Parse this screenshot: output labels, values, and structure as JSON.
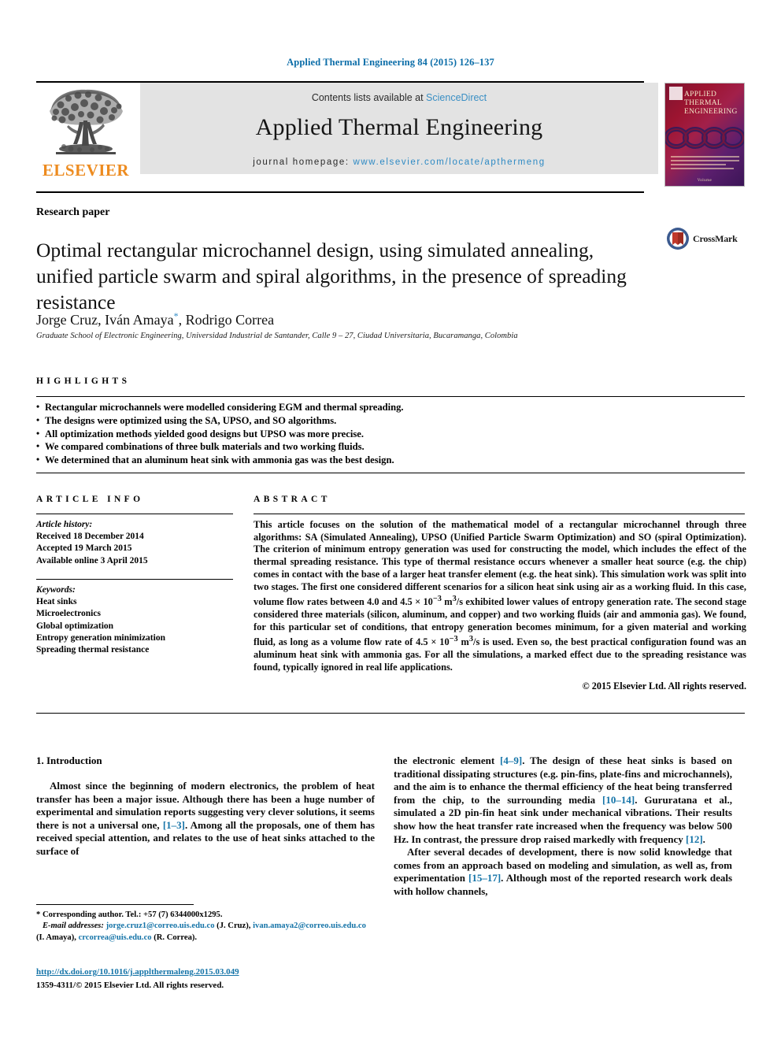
{
  "running_head": "Applied Thermal Engineering 84 (2015) 126–137",
  "masthead": {
    "publisher_name": "ELSEVIER",
    "contents_prefix": "Contents lists available at ",
    "contents_link": "ScienceDirect",
    "journal_title": "Applied Thermal Engineering",
    "homepage_prefix": "journal homepage: ",
    "homepage_link": "www.elsevier.com/locate/apthermeng",
    "cover": {
      "line1": "APPLIED",
      "line2": "THERMAL",
      "line3": "ENGINEERING",
      "footer": "Volume"
    }
  },
  "article": {
    "type": "Research paper",
    "title": "Optimal rectangular microchannel design, using simulated annealing, unified particle swarm and spiral algorithms, in the presence of spreading resistance",
    "crossmark_label": "CrossMark",
    "authors": "Jorge Cruz, Iván Amaya",
    "authors_suffix": ", Rodrigo Correa",
    "corresponding_marker": "*",
    "affiliation": "Graduate School of Electronic Engineering, Universidad Industrial de Santander, Calle 9 – 27, Ciudad Universitaria, Bucaramanga, Colombia"
  },
  "highlights": {
    "heading": "HIGHLIGHTS",
    "items": [
      "Rectangular microchannels were modelled considering EGM and thermal spreading.",
      "The designs were optimized using the SA, UPSO, and SO algorithms.",
      "All optimization methods yielded good designs but UPSO was more precise.",
      "We compared combinations of three bulk materials and two working fluids.",
      "We determined that an aluminum heat sink with ammonia gas was the best design."
    ]
  },
  "article_info": {
    "heading": "ARTICLE INFO",
    "history_label": "Article history:",
    "history": [
      "Received 18 December 2014",
      "Accepted 19 March 2015",
      "Available online 3 April 2015"
    ],
    "keywords_label": "Keywords:",
    "keywords": [
      "Heat sinks",
      "Microelectronics",
      "Global optimization",
      "Entropy generation minimization",
      "Spreading thermal resistance"
    ]
  },
  "abstract": {
    "heading": "ABSTRACT",
    "paragraph_1": "This article focuses on the solution of the mathematical model of a rectangular microchannel through three algorithms: SA (Simulated Annealing), UPSO (Unified Particle Swarm Optimization) and SO (spiral Optimization). The criterion of minimum entropy generation was used for constructing the model, which includes the effect of the thermal spreading resistance. This type of thermal resistance occurs whenever a smaller heat source (e.g. the chip) comes in contact with the base of a larger heat transfer element (e.g. the heat sink). This simulation work was split into two stages. The first one considered different scenarios for a silicon heat sink using air as a working fluid. In this case, volume flow rates between 4.0 and ",
    "flow_value_1": "4.5 × 10",
    "flow_exp_1": "−3",
    "flow_unit_1": " m",
    "flow_unit_sup_1": "3",
    "flow_unit_tail_1": "/s",
    "paragraph_2": " exhibited lower values of entropy generation rate. The second stage considered three materials (silicon, aluminum, and copper) and two working fluids (air and ammonia gas). We found, for this particular set of conditions, that entropy generation becomes minimum, for a given material and working fluid, as long as a volume flow rate of ",
    "paragraph_3": " is used. Even so, the best practical configuration found was an aluminum heat sink with ammonia gas. For all the simulations, a marked effect due to the spreading resistance was found, typically ignored in real life applications.",
    "copyright": "© 2015 Elsevier Ltd. All rights reserved."
  },
  "body": {
    "section_number_title": "1. Introduction",
    "left_paragraph": "Almost since the beginning of modern electronics, the problem of heat transfer has been a major issue. Although there has been a huge number of experimental and simulation reports suggesting very clever solutions, it seems there is not a universal one, ",
    "left_ref": "[1–3]",
    "left_paragraph_cont": ". Among all the proposals, one of them has received special attention, and relates to the use of heat sinks attached to the surface of",
    "right_paragraph_a_1": "the electronic element ",
    "right_ref_1": "[4–9]",
    "right_paragraph_a_2": ". The design of these heat sinks is based on traditional dissipating structures (e.g. pin-fins, plate-fins and microchannels), and the aim is to enhance the thermal efficiency of the heat being transferred from the chip, to the surrounding media ",
    "right_ref_2": "[10–14]",
    "right_paragraph_a_3": ". Gururatana et al., simulated a 2D pin-fin heat sink under mechanical vibrations. Their results show how the heat transfer rate increased when the frequency was below 500 Hz. In contrast, the pressure drop raised markedly with frequency ",
    "right_ref_3": "[12]",
    "right_paragraph_a_4": ".",
    "right_paragraph_b_1": "After several decades of development, there is now solid knowledge that comes from an approach based on modeling and simulation, as well as, from experimentation ",
    "right_ref_4": "[15–17]",
    "right_paragraph_b_2": ". Although most of the reported research work deals with hollow channels,"
  },
  "footnote": {
    "corresponding": "Corresponding author. Tel.: +57 (7) 6344000x1295.",
    "email_label": "E-mail addresses:",
    "email_1": "jorge.cruz1@correo.uis.edu.co",
    "email_1_who": "(J. Cruz),",
    "email_2": "ivan.amaya2@correo.uis.edu.co",
    "email_2_who": "(I. Amaya),",
    "email_3": "crcorrea@uis.edu.co",
    "email_3_who": "(R. Correa).",
    "doi": "http://dx.doi.org/10.1016/j.applthermaleng.2015.03.049",
    "issn_line": "1359-4311/© 2015 Elsevier Ltd. All rights reserved."
  },
  "colors": {
    "link_blue": "#1574a8",
    "elsevier_orange": "#ED8B1F",
    "banner_grey": "#e3e3e3"
  }
}
